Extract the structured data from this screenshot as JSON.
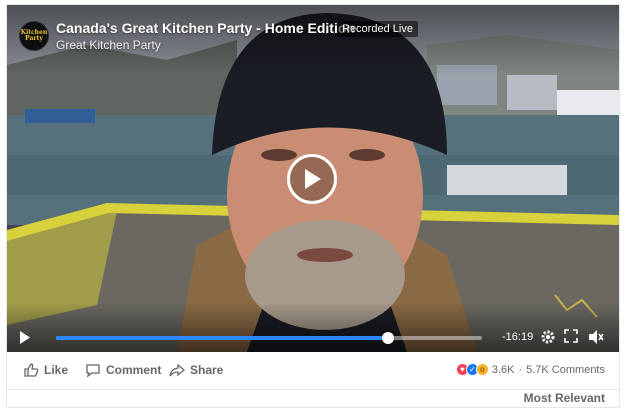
{
  "video": {
    "title": "Canada's Great Kitchen Party - Home Edition",
    "status_badge": "Recorded Live",
    "page_name": "Great Kitchen Party",
    "logo_text": "Kitchen Party",
    "time_remaining": "-16:19",
    "progress_fraction": 0.78,
    "accent_color": "#2d88ff"
  },
  "actions": {
    "like_label": "Like",
    "comment_label": "Comment",
    "share_label": "Share"
  },
  "reactions": {
    "icons": [
      "love-icon",
      "like-icon",
      "wow-icon"
    ],
    "count": "3.6K",
    "separator": "·",
    "comments": "5.7K Comments"
  },
  "comments_sort": {
    "label": "Most Relevant"
  }
}
